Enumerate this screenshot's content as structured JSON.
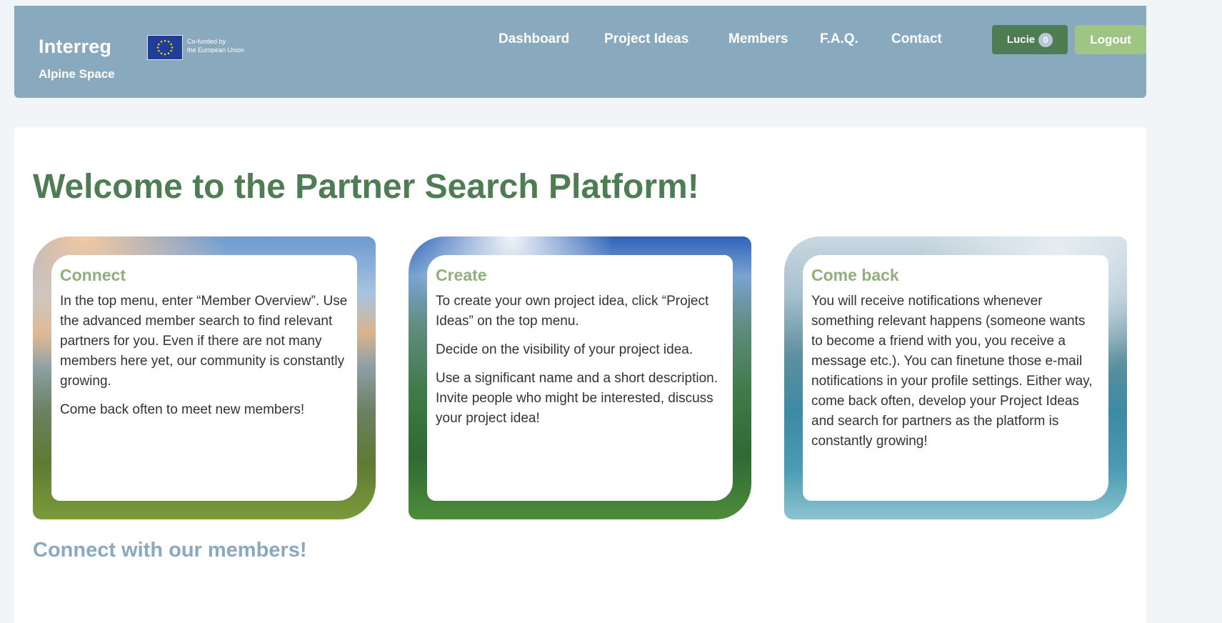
{
  "header": {
    "logo": {
      "name": "Interreg",
      "cofunded_line1": "Co-funded by",
      "cofunded_line2": "the European Union",
      "region": "Alpine Space"
    },
    "nav": [
      "Dashboard",
      "Project Ideas",
      "Members",
      "F.A.Q.",
      "Contact"
    ],
    "user": {
      "name": "Lucie",
      "badge_count": "0"
    },
    "logout_label": "Logout"
  },
  "main": {
    "title": "Welcome to the Partner Search Platform!",
    "cards": [
      {
        "title": "Connect",
        "paragraphs": [
          "In the top menu, enter “Member Overview”. Use the advanced member search to find relevant partners for you. Even if there are not many members here yet, our community is constantly growing.",
          "Come back often to meet new members!"
        ]
      },
      {
        "title": "Create",
        "paragraphs": [
          "To create your own project idea, click “Project Ideas” on the top menu.",
          "Decide on the visibility of your project idea.",
          "Use a significant name and a short description. Invite people who might be interested, discuss your project idea!"
        ]
      },
      {
        "title": "Come back",
        "paragraphs": [
          "You will receive notifications whenever something relevant happens (someone wants to become a friend with you, you receive a message etc.). You can finetune those e-mail notifications in your profile settings. Either way, come back often, develop your Project Ideas and search for partners as the platform is constantly growing!"
        ]
      }
    ],
    "subtitle": "Connect with our members!"
  },
  "colors": {
    "header_bg": "#89a9be",
    "title_green": "#4e7c53",
    "card_title_green": "#8fb07a",
    "user_button": "#4e7c53",
    "logout_button": "#9fc585"
  }
}
